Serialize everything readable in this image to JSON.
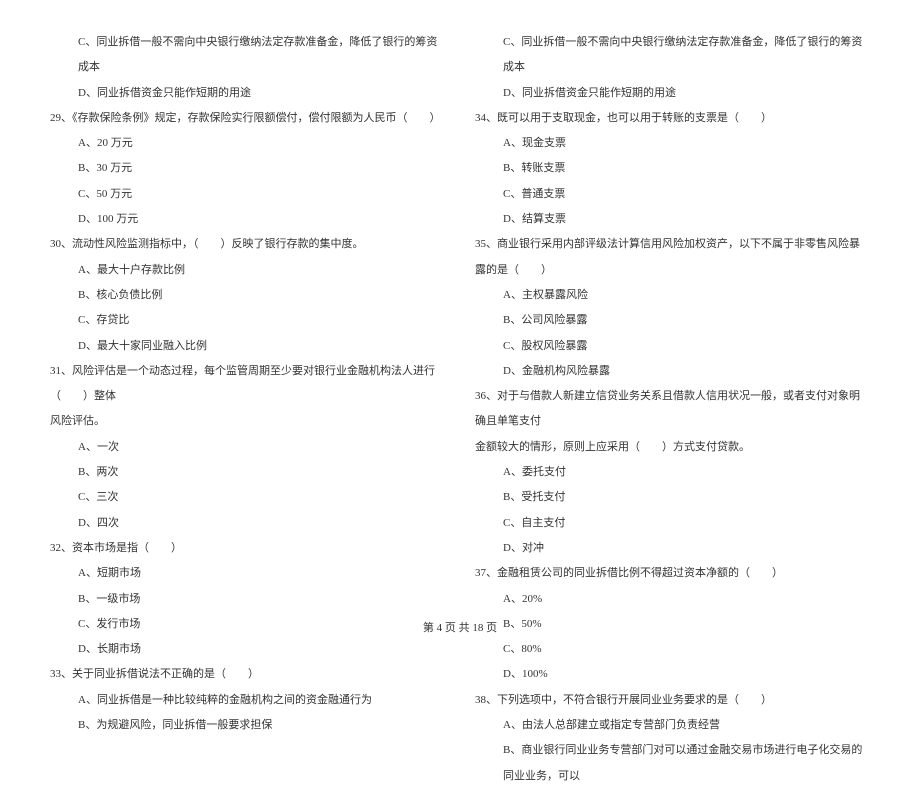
{
  "left": {
    "pre_options": [
      "C、同业拆借一般不需向中央银行缴纳法定存款准备金，降低了银行的筹资成本",
      "D、同业拆借资金只能作短期的用途"
    ],
    "q29": {
      "text": "29、《存款保险条例》规定，存款保险实行限额偿付，偿付限额为人民币（　　）",
      "options": [
        "A、20 万元",
        "B、30 万元",
        "C、50 万元",
        "D、100 万元"
      ]
    },
    "q30": {
      "text": "30、流动性风险监测指标中，（　　）反映了银行存款的集中度。",
      "options": [
        "A、最大十户存款比例",
        "B、核心负债比例",
        "C、存贷比",
        "D、最大十家同业融入比例"
      ]
    },
    "q31": {
      "text": "31、风险评估是一个动态过程，每个监管周期至少要对银行业金融机构法人进行（　　）整体",
      "cont": "风险评估。",
      "options": [
        "A、一次",
        "B、两次",
        "C、三次",
        "D、四次"
      ]
    },
    "q32": {
      "text": "32、资本市场是指（　　）",
      "options": [
        "A、短期市场",
        "B、一级市场",
        "C、发行市场",
        "D、长期市场"
      ]
    },
    "q33": {
      "text": "33、关于同业拆借说法不正确的是（　　）",
      "options": [
        "A、同业拆借是一种比较纯粹的金融机构之间的资金融通行为",
        "B、为规避风险，同业拆借一般要求担保"
      ]
    }
  },
  "right": {
    "pre_options": [
      "C、同业拆借一般不需向中央银行缴纳法定存款准备金，降低了银行的筹资成本",
      "D、同业拆借资金只能作短期的用途"
    ],
    "q34": {
      "text": "34、既可以用于支取现金，也可以用于转账的支票是（　　）",
      "options": [
        "A、现金支票",
        "B、转账支票",
        "C、普通支票",
        "D、结算支票"
      ]
    },
    "q35": {
      "text": "35、商业银行采用内部评级法计算信用风险加权资产，以下不属于非零售风险暴露的是（　　）",
      "options": [
        "A、主权暴露风险",
        "B、公司风险暴露",
        "C、股权风险暴露",
        "D、金融机构风险暴露"
      ]
    },
    "q36": {
      "text": "36、对于与借款人新建立信贷业务关系且借款人信用状况一般，或者支付对象明确且单笔支付",
      "cont": "金额较大的情形，原则上应采用（　　）方式支付贷款。",
      "options": [
        "A、委托支付",
        "B、受托支付",
        "C、自主支付",
        "D、对冲"
      ]
    },
    "q37": {
      "text": "37、金融租赁公司的同业拆借比例不得超过资本净额的（　　）",
      "options": [
        "A、20%",
        "B、50%",
        "C、80%",
        "D、100%"
      ]
    },
    "q38": {
      "text": "38、下列选项中，不符合银行开展同业业务要求的是（　　）",
      "options": [
        "A、由法人总部建立或指定专营部门负责经营",
        "B、商业银行同业业务专营部门对可以通过金融交易市场进行电子化交易的同业业务，可以"
      ]
    }
  },
  "footer": "第 4 页 共 18 页"
}
